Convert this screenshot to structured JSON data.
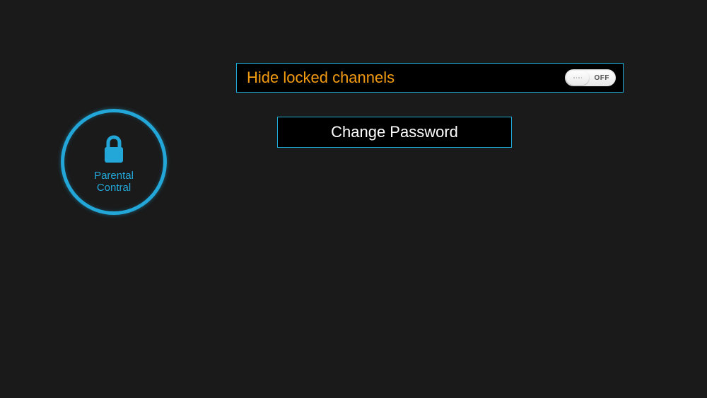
{
  "badge": {
    "title_line1": "Parental",
    "title_line2": "Contral"
  },
  "settings": {
    "hide_locked_label": "Hide locked channels",
    "hide_locked_state": "OFF",
    "change_password_label": "Change Password"
  },
  "colors": {
    "accent": "#22a7d8",
    "highlight": "#f39c12"
  }
}
